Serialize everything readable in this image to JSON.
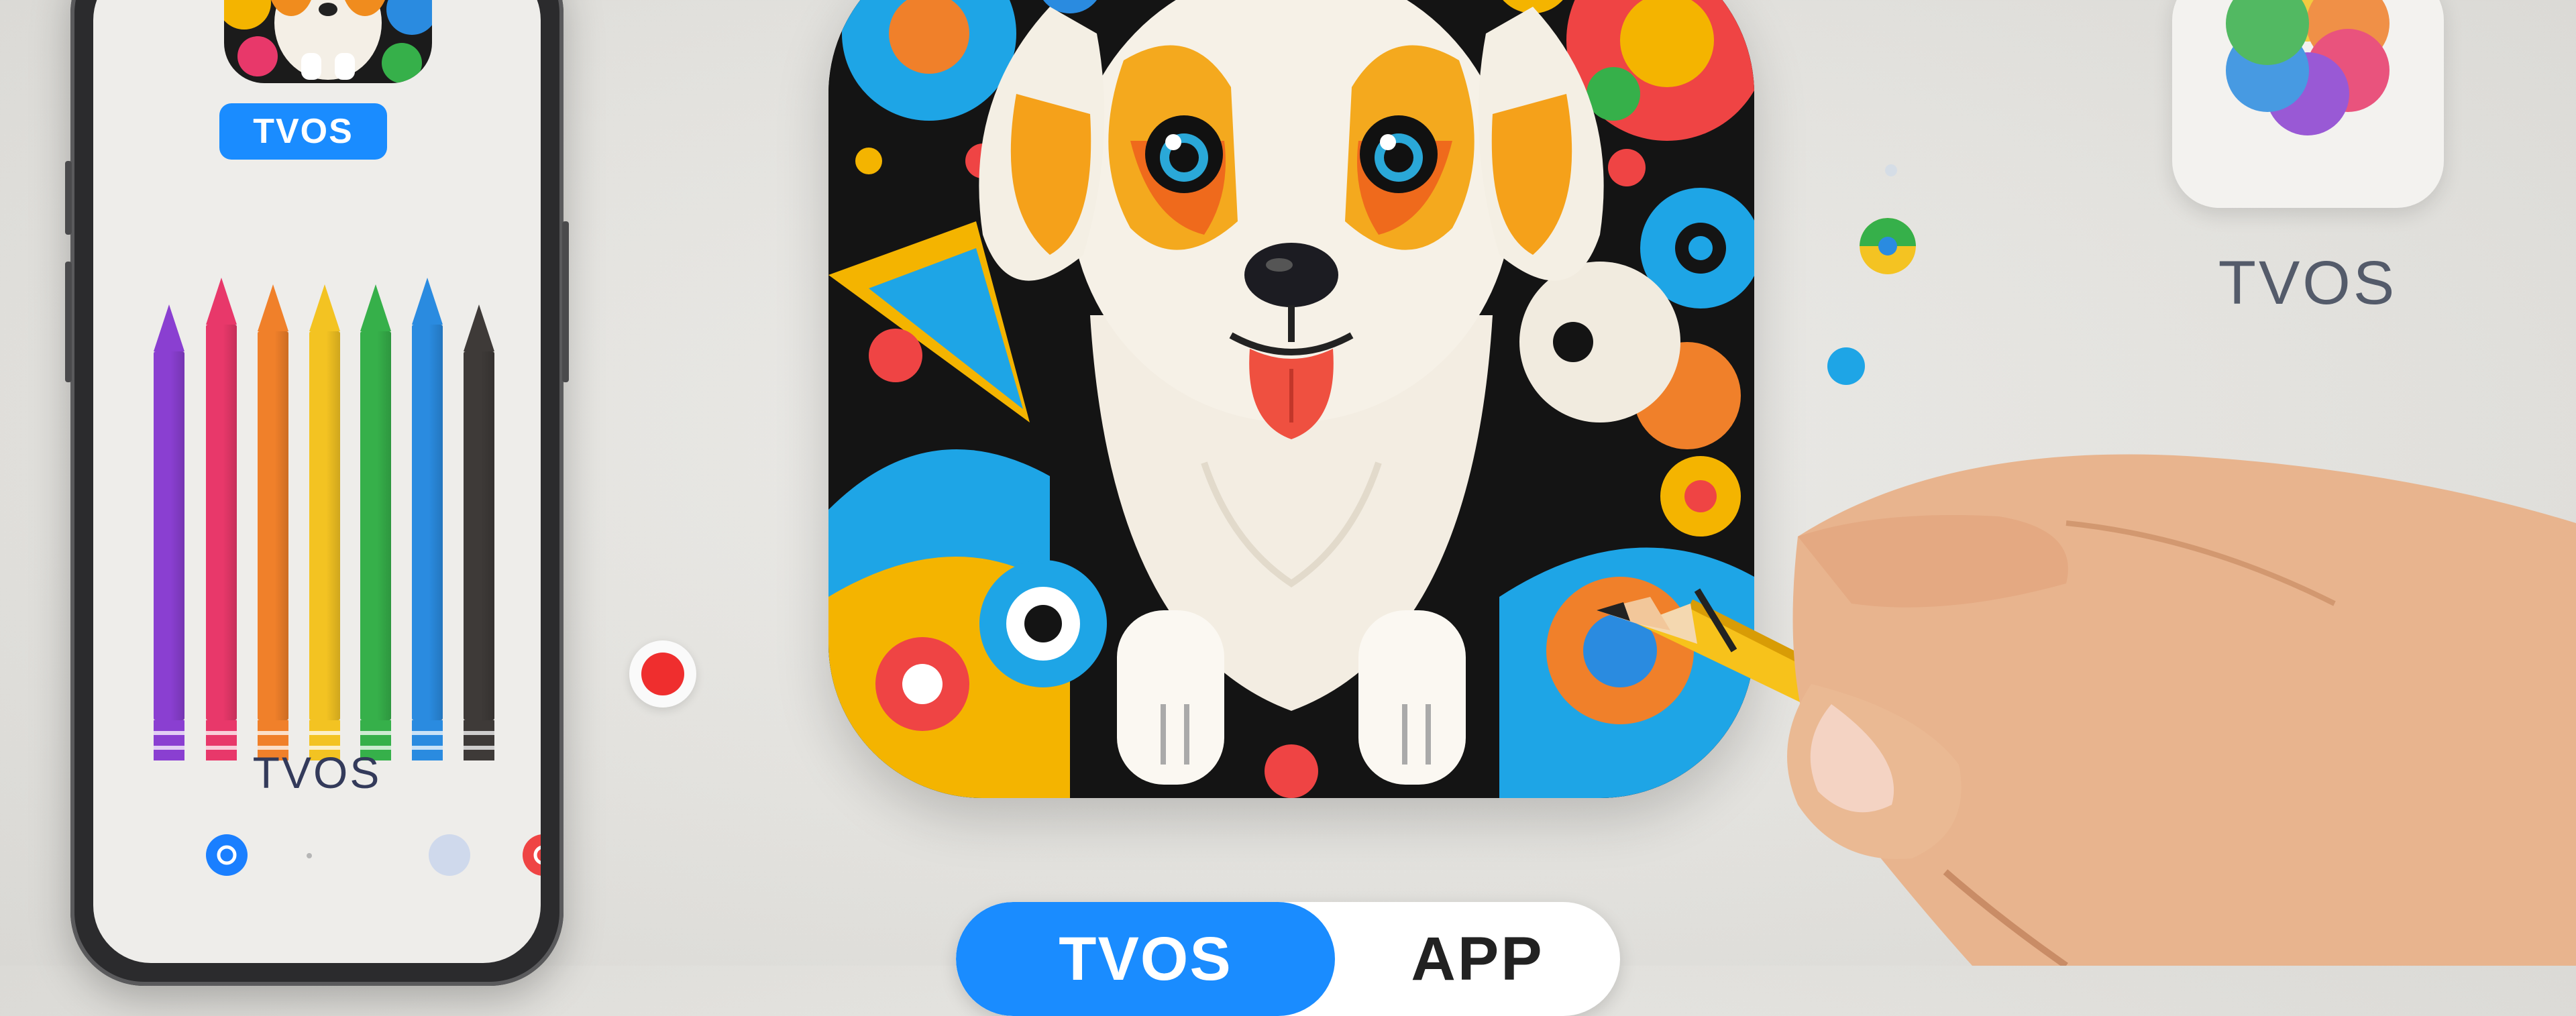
{
  "phone": {
    "pill_label": "TVOS",
    "bottom_label": "TVOS",
    "pencil_colors": [
      "#8a3fd1",
      "#e8386a",
      "#f0802a",
      "#f3c322",
      "#36b04a",
      "#2a8be0",
      "#3e3a38"
    ],
    "dock_colors": [
      "#1a7fff",
      "#b8cdef",
      "#ef4444"
    ]
  },
  "main_icon": {
    "name": "dog-app-icon"
  },
  "right_icon": {
    "label": "TVOS"
  },
  "bottom_toggle": {
    "left_label": "TVOS",
    "right_label": "APP"
  },
  "colors": {
    "accent": "#1a8cff",
    "background": "#e6e5e1"
  }
}
